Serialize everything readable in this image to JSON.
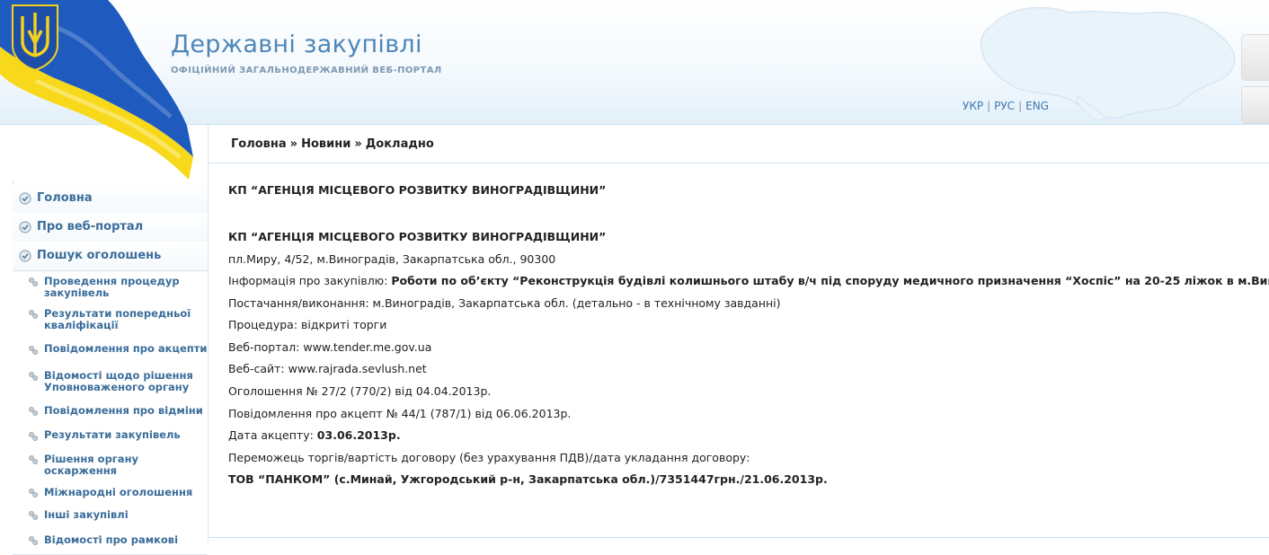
{
  "header": {
    "title": "Державні закупівлі",
    "subtitle": "ОФІЦІЙНИЙ ЗАГАЛЬНОДЕРЖАВНИЙ ВЕБ-ПОРТАЛ",
    "languages": [
      "УКР",
      "РУС",
      "ENG"
    ],
    "separator": "|",
    "map_icon": "ukraine-map-icon",
    "flag_icon": "ukraine-flag-icon",
    "coat_icon": "trident-icon"
  },
  "sidebar": {
    "top_items": [
      {
        "label": "Головна",
        "icon": "check-circle-icon"
      },
      {
        "label": "Про веб-портал",
        "icon": "check-circle-icon"
      },
      {
        "label": "Пошук оголошень",
        "icon": "check-circle-icon"
      }
    ],
    "sub_items": [
      {
        "line1": "Проведення процедур",
        "line2": "закупівель",
        "icon": "bullet-dots-icon"
      },
      {
        "line1": "Результати попередньої",
        "line2": "кваліфікації",
        "icon": "bullet-dots-icon"
      },
      {
        "line1": "Повідомлення про акцепти",
        "line2": "",
        "icon": "bullet-dots-icon"
      },
      {
        "line1": "Відомості щодо рішення",
        "line2": "Уповноваженого органу",
        "icon": "bullet-dots-icon"
      },
      {
        "line1": "Повідомлення про відміни",
        "line2": "",
        "icon": "bullet-dots-icon"
      },
      {
        "line1": "Результати закупівель",
        "line2": "",
        "icon": "bullet-dots-icon"
      },
      {
        "line1": "Рішення органу",
        "line2": "оскарження",
        "icon": "bullet-dots-icon"
      },
      {
        "line1": "Міжнародні оголошення",
        "line2": "",
        "icon": "bullet-dots-icon"
      },
      {
        "line1": "Інші закупівлі",
        "line2": "",
        "icon": "bullet-dots-icon"
      },
      {
        "line1": "Відомості про рамкові",
        "line2": "",
        "icon": "bullet-dots-icon"
      }
    ]
  },
  "breadcrumb": {
    "home": "Головна",
    "news": "Новини",
    "current": "Докладно",
    "sep": "»"
  },
  "content": {
    "heading": "КП “АГЕНЦІЯ МІСЦЕВОГО РОЗВИТКУ ВИНОГРАДІВЩИНИ”",
    "org_name": "КП “АГЕНЦІЯ МІСЦЕВОГО РОЗВИТКУ ВИНОГРАДІВЩИНИ”",
    "address": "пл.Миру, 4/52, м.Виноградів, Закарпатська обл., 90300",
    "info_label": "Інформація про закупівлю: ",
    "info_value": "Роботи по об’єкту “Реконструкція будівлі колишнього штабу в/ч під споруду медичного призначення “Хоспіс” на 20-25 ліжок в м.Виноградів",
    "delivery": "Постачання/виконання: м.Виноградів, Закарпатська обл. (детально - в технічному завданні)",
    "procedure": "Процедура: відкриті торги",
    "webportal": "Веб-портал: www.tender.me.gov.ua",
    "website": "Веб-сайт:  www.rajrada.sevlush.net",
    "announcement": "Оголошення № 27/2 (770/2) від 04.04.2013р.",
    "acceptance_notice": "Повідомлення про акцепт № 44/1 (787/1) від 06.06.2013р.",
    "accept_date_label": "Дата акцепту: ",
    "accept_date_value": "03.06.2013р.",
    "winner_label": "Переможець торгів/вартість договору (без урахування ПДВ)/дата укладання договору:",
    "winner_value": "ТОВ “ПАНКОМ” (с.Минай, Ужгородський р-н, Закарпатська обл.)/7351447грн./21.06.2013р."
  },
  "colors": {
    "title": "#4f86b8",
    "link": "#3a6d9a",
    "flag_blue": "#1f5bbf",
    "flag_yellow": "#f7d81a"
  }
}
